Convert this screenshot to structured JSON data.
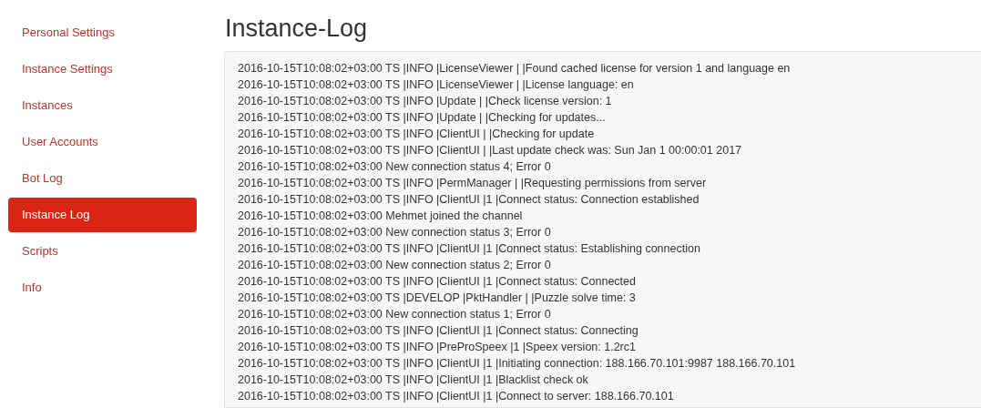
{
  "sidebar": {
    "items": [
      {
        "label": "Personal Settings",
        "selected": false
      },
      {
        "label": "Instance Settings",
        "selected": false
      },
      {
        "label": "Instances",
        "selected": false
      },
      {
        "label": "User Accounts",
        "selected": false
      },
      {
        "label": "Bot Log",
        "selected": false
      },
      {
        "label": "Instance Log",
        "selected": true
      },
      {
        "label": "Scripts",
        "selected": false
      },
      {
        "label": "Info",
        "selected": false
      }
    ]
  },
  "page": {
    "title": "Instance-Log"
  },
  "log": {
    "lines": [
      "2016-10-15T10:08:02+03:00 TS |INFO |LicenseViewer | |Found cached license for version 1 and language en",
      "2016-10-15T10:08:02+03:00 TS |INFO |LicenseViewer | |License language: en",
      "2016-10-15T10:08:02+03:00 TS |INFO |Update | |Check license version: 1",
      "2016-10-15T10:08:02+03:00 TS |INFO |Update | |Checking for updates...",
      "2016-10-15T10:08:02+03:00 TS |INFO |ClientUI | |Checking for update",
      "2016-10-15T10:08:02+03:00 TS |INFO |ClientUI | |Last update check was: Sun Jan 1 00:00:01 2017",
      "2016-10-15T10:08:02+03:00 New connection status 4; Error 0",
      "2016-10-15T10:08:02+03:00 TS |INFO |PermManager | |Requesting permissions from server",
      "2016-10-15T10:08:02+03:00 TS |INFO |ClientUI |1 |Connect status: Connection established",
      "2016-10-15T10:08:02+03:00 Mehmet joined the channel",
      "2016-10-15T10:08:02+03:00 New connection status 3; Error 0",
      "2016-10-15T10:08:02+03:00 TS |INFO |ClientUI |1 |Connect status: Establishing connection",
      "2016-10-15T10:08:02+03:00 New connection status 2; Error 0",
      "2016-10-15T10:08:02+03:00 TS |INFO |ClientUI |1 |Connect status: Connected",
      "2016-10-15T10:08:02+03:00 TS |DEVELOP |PktHandler | |Puzzle solve time: 3",
      "2016-10-15T10:08:02+03:00 New connection status 1; Error 0",
      "2016-10-15T10:08:02+03:00 TS |INFO |ClientUI |1 |Connect status: Connecting",
      "2016-10-15T10:08:02+03:00 TS |INFO |PreProSpeex |1 |Speex version: 1.2rc1",
      "2016-10-15T10:08:02+03:00 TS |INFO |ClientUI |1 |Initiating connection: 188.166.70.101:9987 188.166.70.101",
      "2016-10-15T10:08:02+03:00 TS |INFO |ClientUI |1 |Blacklist check ok",
      "2016-10-15T10:08:02+03:00 TS |INFO |ClientUI |1 |Connect to server: 188.166.70.101"
    ]
  }
}
